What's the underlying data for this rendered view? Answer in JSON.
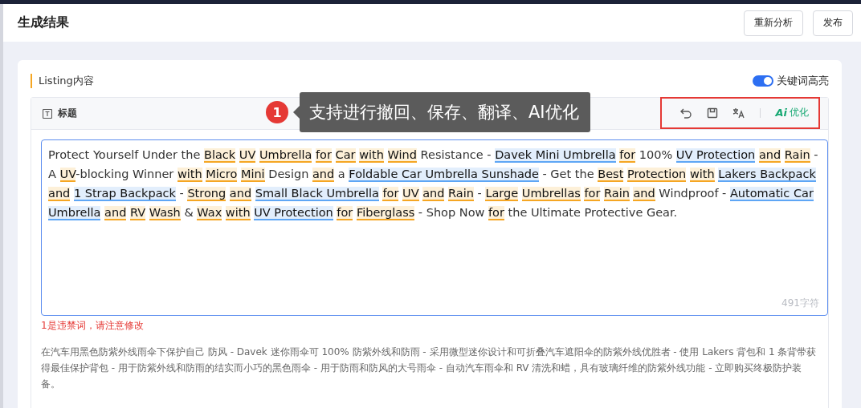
{
  "header": {
    "title": "生成结果",
    "buttons": [
      "重新分析",
      "发布"
    ]
  },
  "section": {
    "title": "Listing内容",
    "keyword_highlight": {
      "label": "关键词高亮",
      "on": true
    }
  },
  "field": {
    "title": "标题",
    "toolbar": [
      {
        "kind": "undo"
      },
      {
        "kind": "save"
      },
      {
        "kind": "translate"
      },
      {
        "kind": "ai",
        "logo": "Ai",
        "label": "优化"
      }
    ],
    "segments": [
      {
        "kind": "plain",
        "text": "Protect Yourself Under the "
      },
      {
        "kind": "word",
        "text": "Black"
      },
      {
        "kind": "word",
        "text": "UV"
      },
      {
        "kind": "word",
        "text": "Umbrella"
      },
      {
        "kind": "word",
        "text": "for"
      },
      {
        "kind": "word",
        "text": "Car"
      },
      {
        "kind": "word",
        "text": "with"
      },
      {
        "kind": "word",
        "text": "Wind"
      },
      {
        "kind": "plain",
        "text": " Resistance - "
      },
      {
        "kind": "phrase",
        "text": "Davek Mini Umbrella"
      },
      {
        "kind": "word",
        "text": "for"
      },
      {
        "kind": "plain",
        "text": " 100% "
      },
      {
        "kind": "phrase",
        "text": "UV Protection"
      },
      {
        "kind": "word",
        "text": "and"
      },
      {
        "kind": "word",
        "text": "Rain"
      },
      {
        "kind": "plain",
        "text": " - A "
      },
      {
        "kind": "word",
        "text": "UV"
      },
      {
        "kind": "plain",
        "text": "-blocking Winner "
      },
      {
        "kind": "word",
        "text": "with"
      },
      {
        "kind": "word",
        "text": "Micro"
      },
      {
        "kind": "word",
        "text": "Mini"
      },
      {
        "kind": "plain",
        "text": " Design "
      },
      {
        "kind": "word",
        "text": "and"
      },
      {
        "kind": "plain",
        "text": " a "
      },
      {
        "kind": "phrase",
        "text": "Foldable Car Umbrella Sunshade"
      },
      {
        "kind": "plain",
        "text": " - Get the "
      },
      {
        "kind": "word",
        "text": "Best"
      },
      {
        "kind": "word",
        "text": "Protection"
      },
      {
        "kind": "word",
        "text": "with"
      },
      {
        "kind": "phrase",
        "text": "Lakers Backpack"
      },
      {
        "kind": "word",
        "text": "and"
      },
      {
        "kind": "phrase",
        "text": "1 Strap Backpack"
      },
      {
        "kind": "plain",
        "text": " - "
      },
      {
        "kind": "word",
        "text": "Strong"
      },
      {
        "kind": "word",
        "text": "and"
      },
      {
        "kind": "phrase",
        "text": "Small Black Umbrella"
      },
      {
        "kind": "word",
        "text": "for"
      },
      {
        "kind": "word",
        "text": "UV"
      },
      {
        "kind": "word",
        "text": "and"
      },
      {
        "kind": "word",
        "text": "Rain"
      },
      {
        "kind": "plain",
        "text": " - "
      },
      {
        "kind": "word",
        "text": "Large"
      },
      {
        "kind": "word",
        "text": "Umbrellas"
      },
      {
        "kind": "word",
        "text": "for"
      },
      {
        "kind": "word",
        "text": "Rain"
      },
      {
        "kind": "word",
        "text": "and"
      },
      {
        "kind": "plain",
        "text": " Windproof - "
      },
      {
        "kind": "phrase",
        "text": "Automatic Car Umbrella"
      },
      {
        "kind": "word",
        "text": "and"
      },
      {
        "kind": "word",
        "text": "RV"
      },
      {
        "kind": "word",
        "text": "Wash"
      },
      {
        "kind": "plain",
        "text": " & "
      },
      {
        "kind": "word",
        "text": "Wax"
      },
      {
        "kind": "word",
        "text": "with"
      },
      {
        "kind": "phrase",
        "text": "UV Protection"
      },
      {
        "kind": "word",
        "text": "for"
      },
      {
        "kind": "word",
        "text": "Fiberglass"
      },
      {
        "kind": "plain",
        "text": " - Shop Now "
      },
      {
        "kind": "word",
        "text": "for"
      },
      {
        "kind": "plain",
        "text": " the Ultimate Protective Gear."
      }
    ],
    "char_count": "491字符",
    "warning": "1是违禁词，请注意修改",
    "translation": "在汽车用黑色防紫外线雨伞下保护自己 防风 - Davek 迷你雨伞可 100% 防紫外线和防雨 - 采用微型迷你设计和可折叠汽车遮阳伞的防紫外线优胜者 - 使用 Lakers 背包和 1 条背带获得最佳保护背包 - 用于防紫外线和防雨的结实而小巧的黑色雨伞 - 用于防雨和防风的大号雨伞 - 自动汽车雨伞和 RV 清洗和蜡，具有玻璃纤维的防紫外线功能 - 立即购买终极防护装备。"
  },
  "annotation": {
    "number": "1",
    "text": "支持进行撤回、保存、翻译、AI优化"
  }
}
